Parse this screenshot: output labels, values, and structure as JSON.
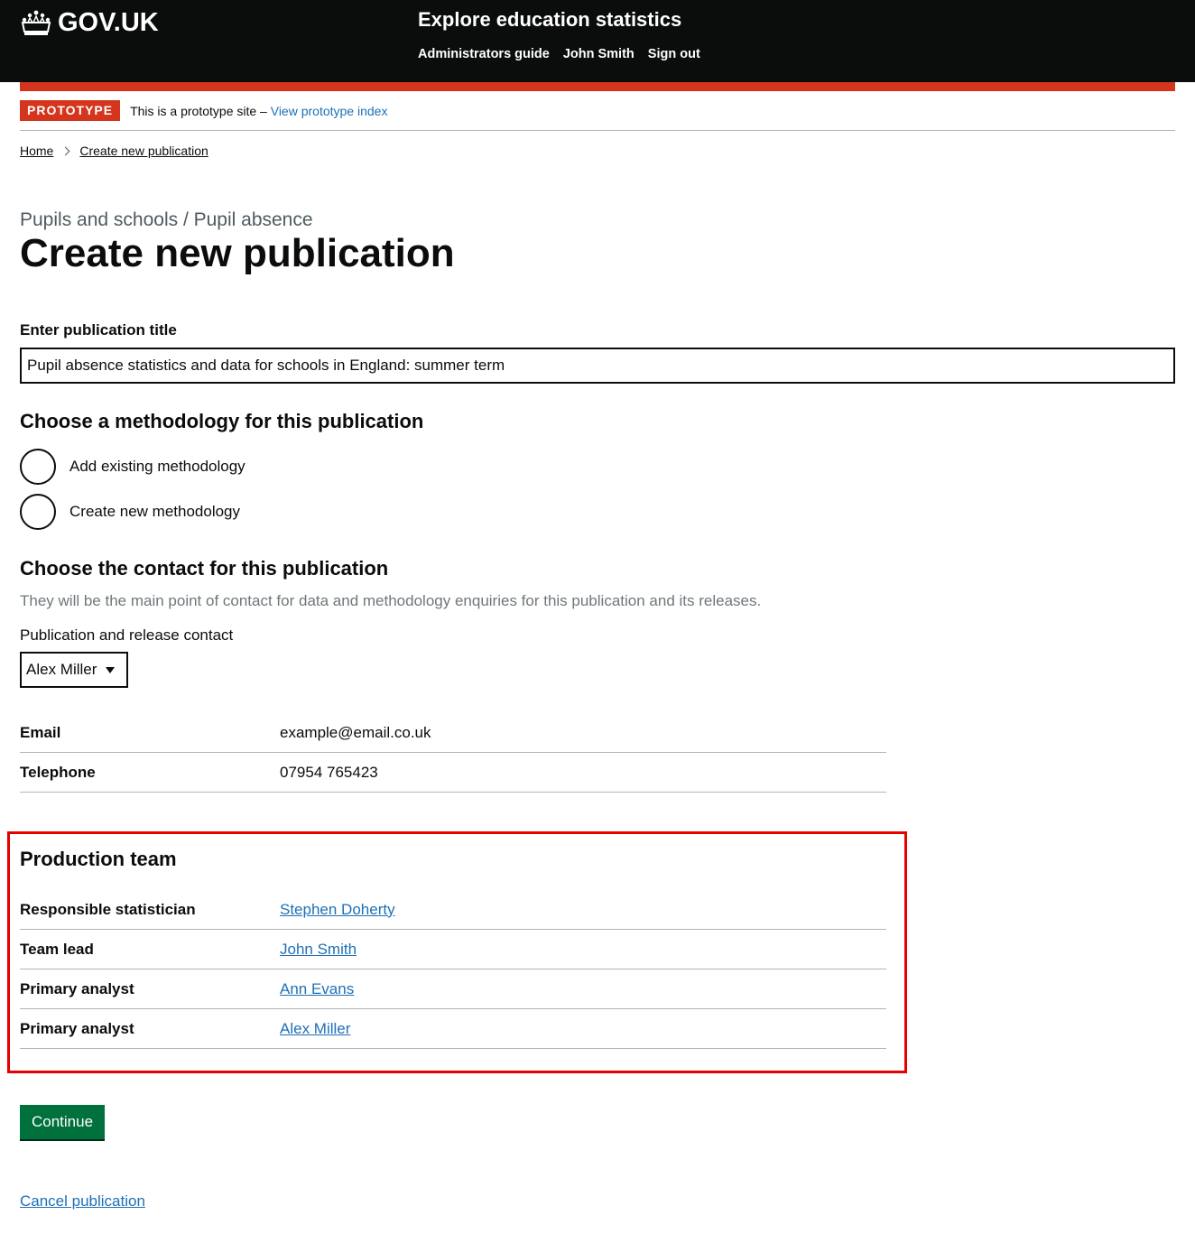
{
  "header": {
    "logo_text": "GOV.UK",
    "service_name": "Explore education statistics",
    "nav": [
      "Administrators guide",
      "John Smith",
      "Sign out"
    ]
  },
  "phase_banner": {
    "tag": "PROTOTYPE",
    "text": "This is a prototype site –",
    "link": "View prototype index"
  },
  "breadcrumb": [
    "Home",
    "Create new publication"
  ],
  "caption": "Pupils and schools / Pupil absence",
  "page_title": "Create new publication",
  "title_field": {
    "label": "Enter publication title",
    "value": "Pupil absence statistics and data for schools in England: summer term"
  },
  "methodology": {
    "heading": "Choose a methodology for this publication",
    "options": [
      "Add existing methodology",
      "Create new methodology"
    ]
  },
  "contact": {
    "heading": "Choose the contact for this publication",
    "hint": "They will be the main point of contact for data and methodology enquiries for this publication and its releases.",
    "select_label": "Publication and release contact",
    "selected": "Alex Miller",
    "details": [
      {
        "key": "Email",
        "value": "example@email.co.uk"
      },
      {
        "key": "Telephone",
        "value": "07954 765423"
      }
    ]
  },
  "team": {
    "heading": "Production team",
    "members": [
      {
        "role": "Responsible statistician",
        "name": "Stephen Doherty"
      },
      {
        "role": "Team lead",
        "name": "John Smith"
      },
      {
        "role": "Primary analyst",
        "name": "Ann Evans"
      },
      {
        "role": "Primary analyst",
        "name": "Alex Miller"
      }
    ]
  },
  "actions": {
    "continue": "Continue",
    "cancel": "Cancel publication"
  },
  "colors": {
    "header_bg": "#0b0c0c",
    "brand_red": "#d4351c",
    "link": "#1d70b8",
    "button_green": "#00703c",
    "highlight": "#e60000"
  }
}
